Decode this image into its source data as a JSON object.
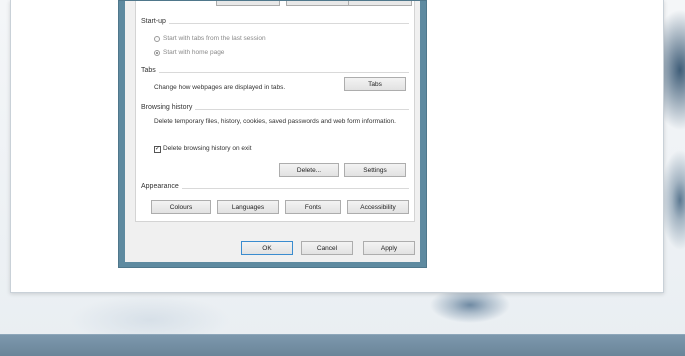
{
  "startup": {
    "title": "Start-up",
    "option_last_session": "Start with tabs from the last session",
    "option_home_page": "Start with home page",
    "selected": "home_page"
  },
  "tabs_group": {
    "title": "Tabs",
    "description": "Change how webpages are displayed in tabs.",
    "tabs_button": "Tabs"
  },
  "browsing_history": {
    "title": "Browsing history",
    "description": "Delete temporary files, history, cookies, saved passwords and web form information.",
    "delete_on_exit_label": "Delete browsing history on exit",
    "delete_on_exit_checked": true,
    "delete_button": "Delete...",
    "settings_button": "Settings"
  },
  "appearance": {
    "title": "Appearance",
    "buttons": [
      "Colours",
      "Languages",
      "Fonts",
      "Accessibility"
    ]
  },
  "footer": {
    "ok": "OK",
    "cancel": "Cancel",
    "apply": "Apply"
  },
  "colors": {
    "dialog_frame": "#5e8aa0",
    "taskbar": "#6f8a9e",
    "default_button_border": "#3a8ccf"
  },
  "icons": {
    "checkbox_checked": "check-mark-icon"
  }
}
